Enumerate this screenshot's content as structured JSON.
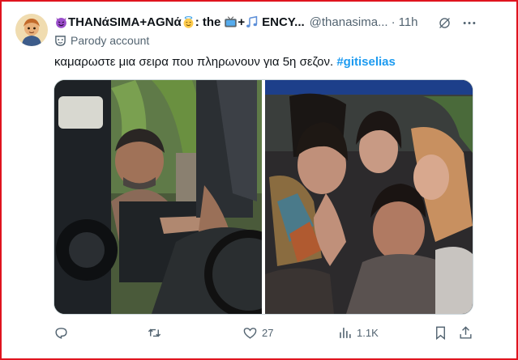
{
  "tweet": {
    "display_name": "THANάSIMA+AGNά",
    "display_name_tail": ": the",
    "display_name_end": "ENCY...",
    "handle": "@thanasima...",
    "separator": "·",
    "timestamp": "11h",
    "parody_label": "Parody account",
    "text": "καμαρωστε μια σειρα που πληρωνουν για 5η σεζον.",
    "hashtag": "#gitiselias"
  },
  "actions": {
    "likes": "27",
    "views": "1.1K"
  },
  "colors": {
    "frame_border": "#e0141e",
    "hashtag": "#1d9bf0",
    "muted": "#536471"
  },
  "icons": [
    "devil-emoji-icon",
    "angel-emoji-icon",
    "tv-emoji-icon",
    "music-notes-emoji-icon",
    "grok-icon",
    "more-icon",
    "parody-mask-icon",
    "reply-icon",
    "retweet-icon",
    "like-icon",
    "views-icon",
    "bookmark-icon",
    "share-icon"
  ]
}
